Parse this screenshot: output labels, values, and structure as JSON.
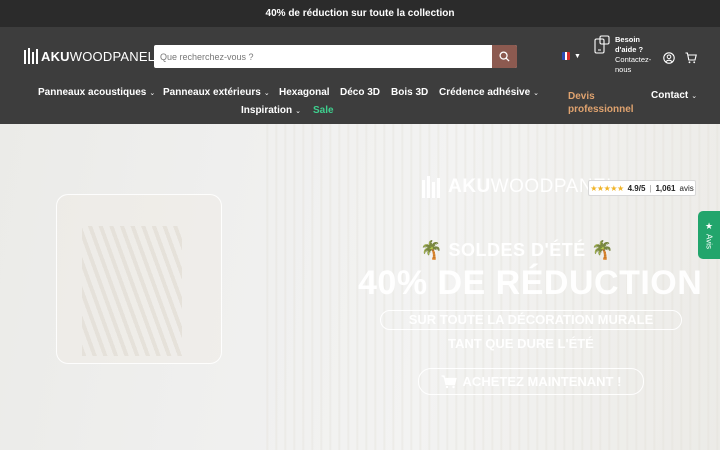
{
  "announcement": "40% de réduction sur toute la collection",
  "brand": {
    "bold": "AKU",
    "light": "WOODPANEL"
  },
  "search": {
    "placeholder": "Que recherchez-vous ?"
  },
  "help": {
    "title": "Besoin d'aide ?",
    "subtitle": "Contactez-nous"
  },
  "nav": {
    "items": [
      {
        "label": "Panneaux acoustiques",
        "dropdown": true
      },
      {
        "label": "Panneaux extérieurs",
        "dropdown": true
      },
      {
        "label": "Hexagonal",
        "dropdown": false
      },
      {
        "label": "Déco 3D",
        "dropdown": false
      },
      {
        "label": "Bois 3D",
        "dropdown": false
      },
      {
        "label": "Crédence adhésive",
        "dropdown": true
      },
      {
        "label": "Inspiration",
        "dropdown": true
      },
      {
        "label": "Sale",
        "dropdown": false
      }
    ],
    "devis": "Devis professionnel",
    "contact": "Contact"
  },
  "hero": {
    "line1": "SOLDES D'ÉTÉ",
    "line2": "40% DE RÉDUCTION",
    "line3": "SUR TOUTE LA DÉCORATION MURALE",
    "line4": "TANT QUE DURE L'ÉTÉ",
    "cta": "ACHETEZ MAINTENANT !"
  },
  "rating": {
    "score": "4.9/5",
    "count": "1,061",
    "suffix": "avis"
  },
  "avis_tab": "Avis",
  "colors": {
    "accent_search": "#8c5a50",
    "sale": "#3ecf8e",
    "devis": "#e0a36f",
    "avis_tab": "#22a56c"
  }
}
